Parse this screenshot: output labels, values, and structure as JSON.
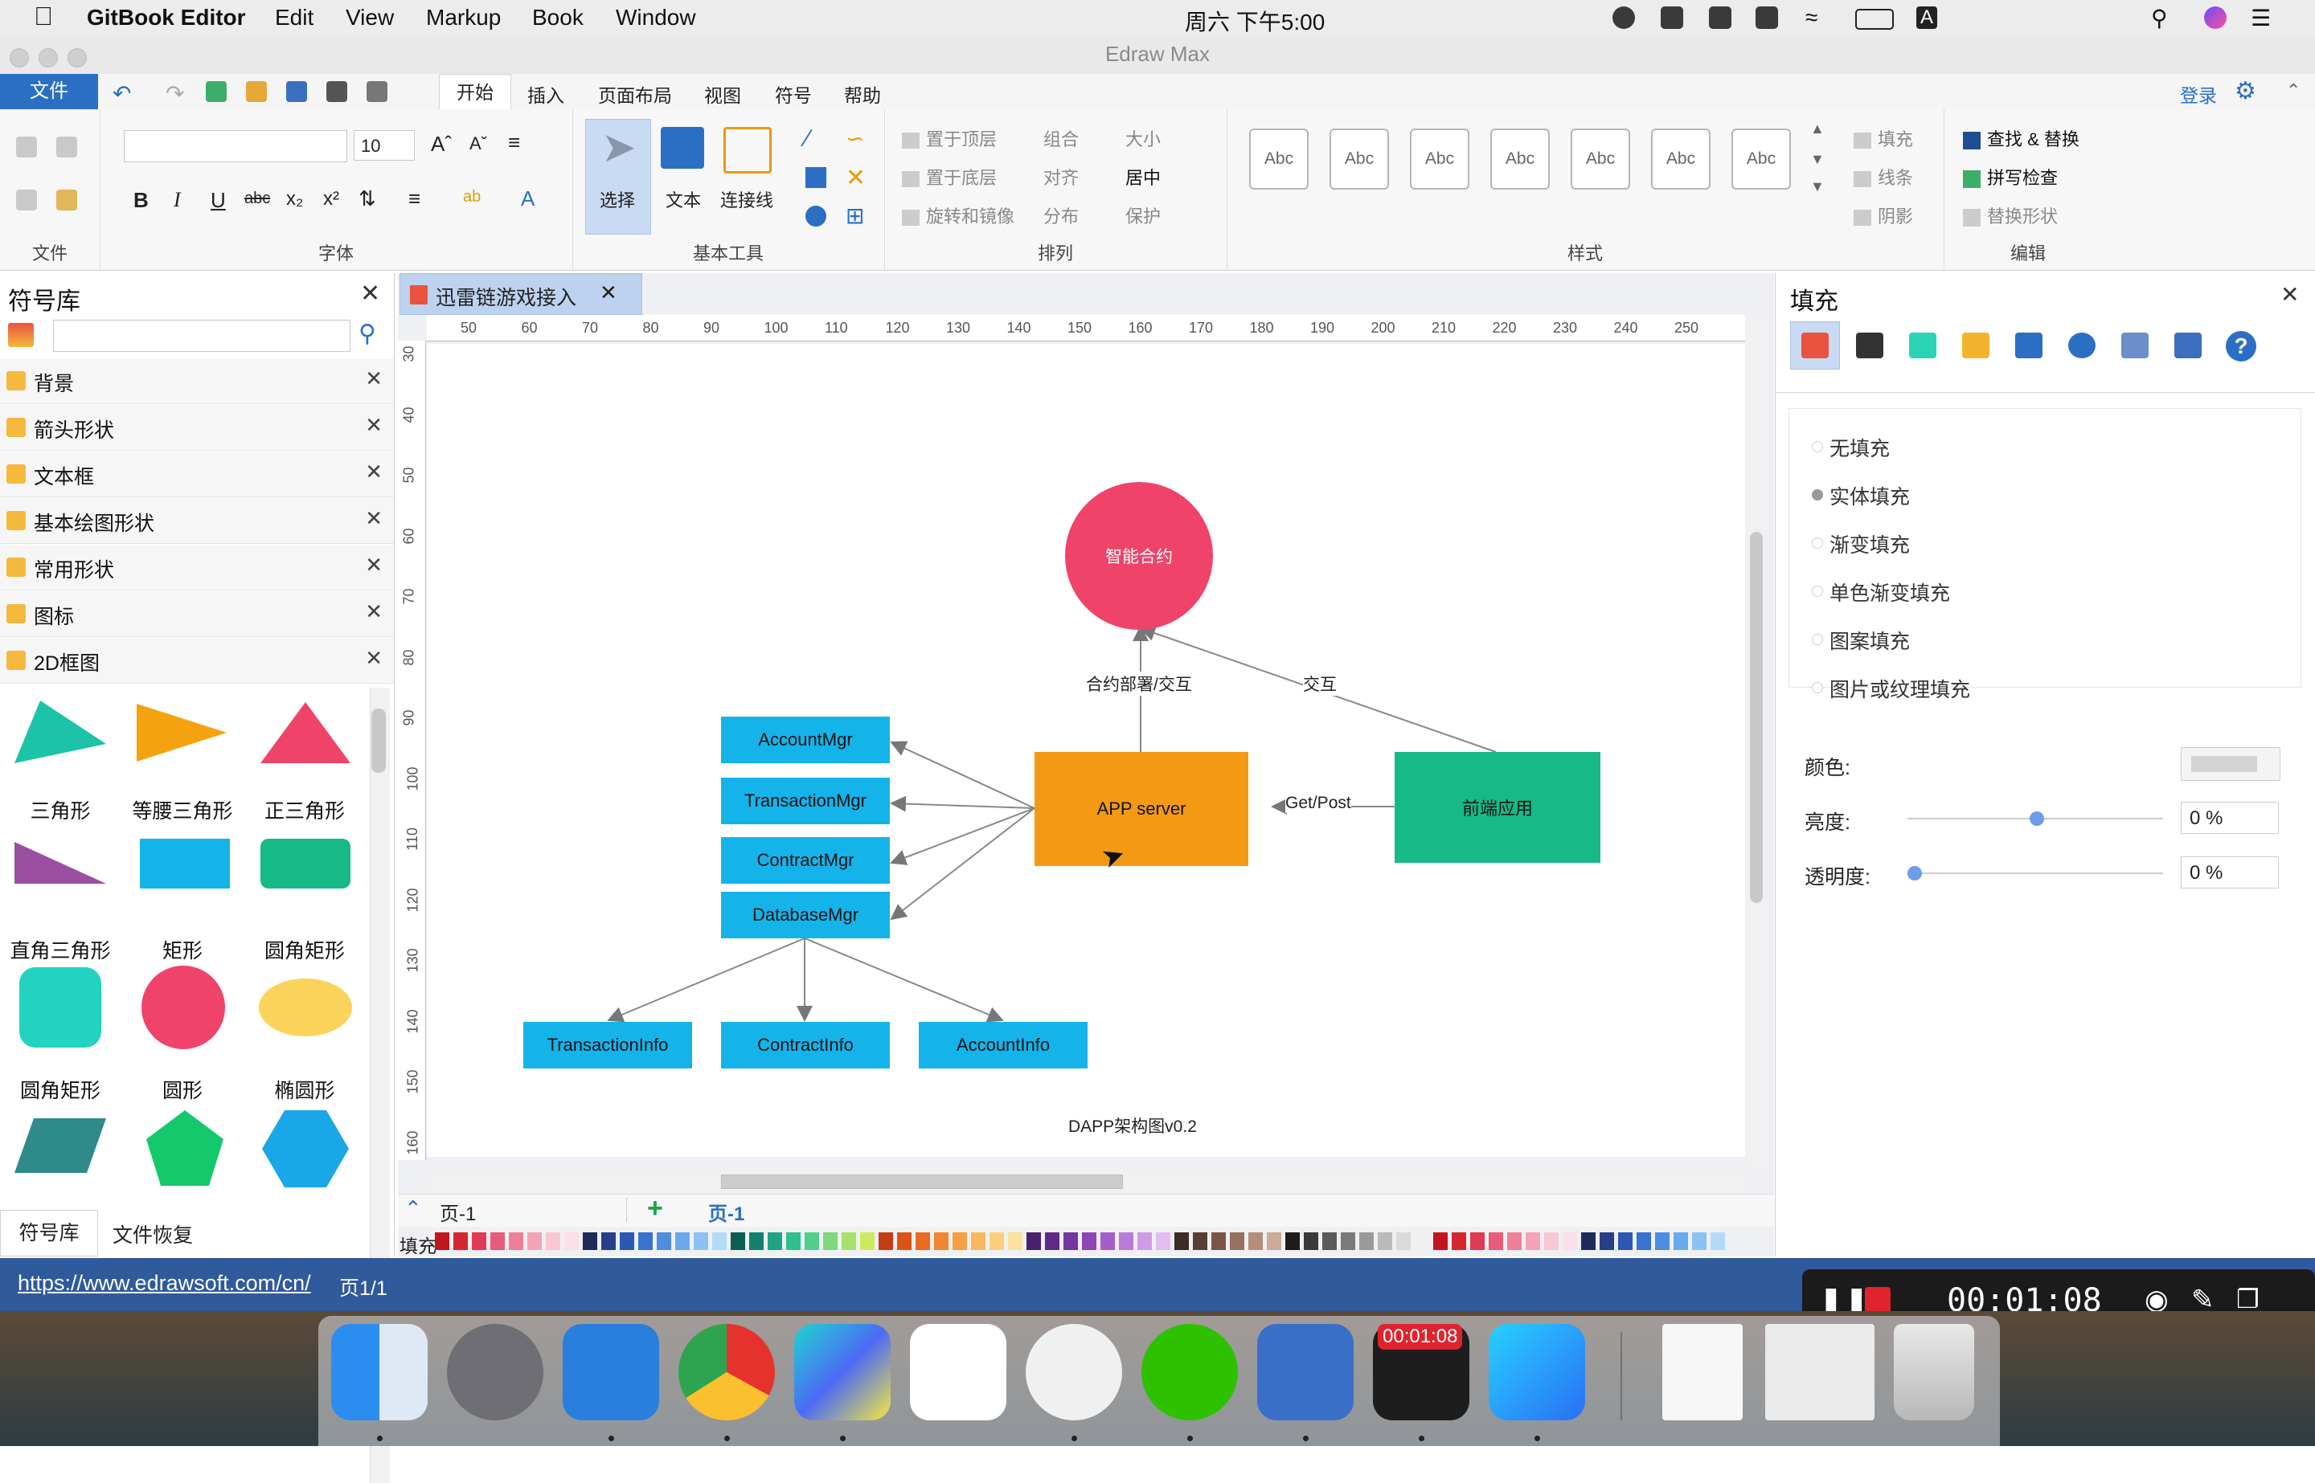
{
  "menubar": {
    "app_name": "GitBook Editor",
    "items": [
      "Edit",
      "View",
      "Markup",
      "Book",
      "Window"
    ],
    "clock": "周六 下午5:00",
    "input_indicator": "A"
  },
  "window": {
    "title": "Edraw Max"
  },
  "ribbon_tabs": {
    "file": "文件",
    "tabs": [
      "开始",
      "插入",
      "页面布局",
      "视图",
      "符号",
      "帮助"
    ],
    "login": "登录"
  },
  "ribbon": {
    "font_size": "10",
    "groups": {
      "file": "文件",
      "font": "字体",
      "basic_tools": "基本工具",
      "arrange": "排列",
      "style": "样式",
      "edit": "编辑"
    },
    "tools": {
      "select": "选择",
      "text": "文本",
      "connector": "连接线"
    },
    "arrange": {
      "bring_front": "置于顶层",
      "send_back": "置于底层",
      "rotate_mirror": "旋转和镜像",
      "group": "组合",
      "align": "对齐",
      "distribute": "分布",
      "size": "大小",
      "center": "居中",
      "protect": "保护"
    },
    "style_samples": [
      "Abc",
      "Abc",
      "Abc",
      "Abc",
      "Abc",
      "Abc",
      "Abc"
    ],
    "style_props": {
      "fill": "填充",
      "line": "线条",
      "shadow": "阴影"
    },
    "edit": {
      "find_replace": "查找 & 替换",
      "spellcheck": "拼写检查",
      "replace_shape": "替换形状"
    }
  },
  "symbol_library": {
    "title": "符号库",
    "categories": [
      "背景",
      "箭头形状",
      "文本框",
      "基本绘图形状",
      "常用形状",
      "图标",
      "2D框图"
    ],
    "shapes": [
      "三角形",
      "等腰三角形",
      "正三角形",
      "直角三角形",
      "矩形",
      "圆角矩形",
      "圆角矩形",
      "圆形",
      "椭圆形"
    ],
    "bottom_tabs": [
      "符号库",
      "文件恢复"
    ]
  },
  "document": {
    "tab_title": "迅雷链游戏接入",
    "ruler_h": [
      "50",
      "60",
      "70",
      "80",
      "90",
      "100",
      "110",
      "120",
      "130",
      "140",
      "150",
      "160",
      "170",
      "180",
      "190",
      "200",
      "210",
      "220",
      "230",
      "240",
      "250"
    ],
    "ruler_v": [
      "30",
      "40",
      "50",
      "60",
      "70",
      "80",
      "90",
      "100",
      "110",
      "120",
      "130",
      "140",
      "150",
      "160"
    ],
    "page_selector": "页-1",
    "page_tab": "页-1",
    "fill_label": "填充"
  },
  "diagram": {
    "smart_contract": "智能合约",
    "app_server": "APP server",
    "frontend": "前端应用",
    "mgrs": [
      "AccountMgr",
      "TransactionMgr",
      "ContractMgr",
      "DatabaseMgr"
    ],
    "infos": [
      "TransactionInfo",
      "ContractInfo",
      "AccountInfo"
    ],
    "edge_deploy": "合约部署/交互",
    "edge_interact": "交互",
    "edge_getpost": "Get/Post",
    "caption": "DAPP架构图v0.2",
    "colors": {
      "circle": "#f0436a",
      "server": "#f39a12",
      "frontend": "#17b986",
      "box": "#14b4ea"
    }
  },
  "fill_panel": {
    "title": "填充",
    "options": [
      "无填充",
      "实体填充",
      "渐变填充",
      "单色渐变填充",
      "图案填充",
      "图片或纹理填充"
    ],
    "color_label": "颜色:",
    "brightness_label": "亮度:",
    "brightness_value": "0 %",
    "transparency_label": "透明度:",
    "transparency_value": "0 %"
  },
  "statusbar": {
    "url": "https://www.edrawsoft.com/cn/",
    "page_info": "页1/1",
    "recording_time": "00:01:08"
  },
  "dock": {
    "badge_time": "00:01:08"
  }
}
